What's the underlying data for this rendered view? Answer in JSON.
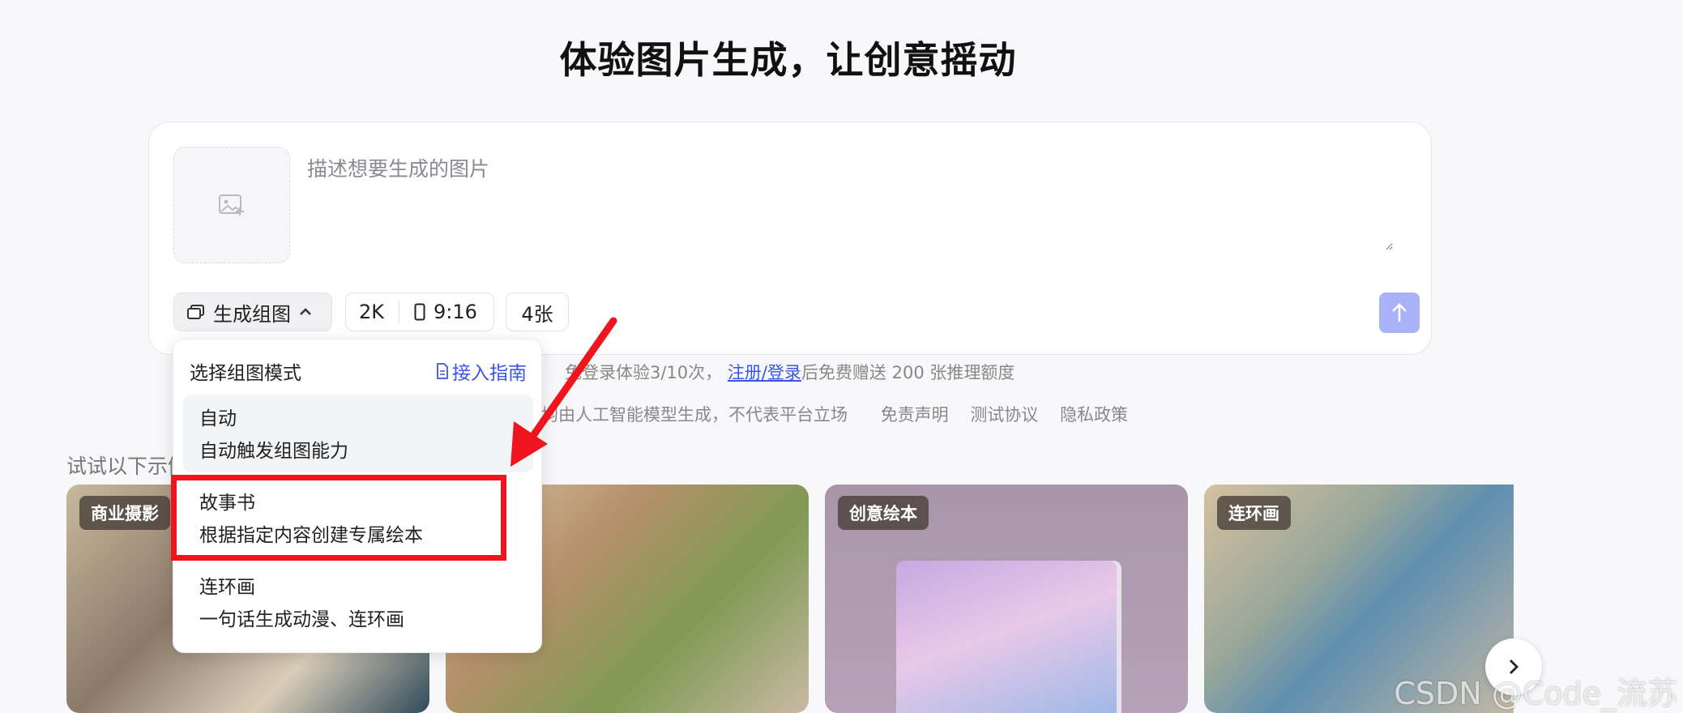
{
  "title": "体验图片生成，让创意摇动",
  "prompt": {
    "placeholder": "描述想要生成的图片"
  },
  "options": {
    "mode_label": "生成组图",
    "resolution": "2K",
    "ratio": "9:16",
    "count": "4张"
  },
  "notes": {
    "quota_text": "免登录体验3/10次，",
    "register_link": "注册/登录",
    "gift_text": "后免费赠送 200 张推理额度",
    "disclaimer": "均由人工智能模型生成，不代表平台立场",
    "links": [
      "免责声明",
      "测试协议",
      "隐私政策"
    ]
  },
  "try_label": "试试以下示例",
  "dropdown": {
    "title": "选择组图模式",
    "guide": "接入指南",
    "items": [
      {
        "title": "自动",
        "desc": "自动触发组图能力"
      },
      {
        "title": "故事书",
        "desc": "根据指定内容创建专属绘本"
      },
      {
        "title": "连环画",
        "desc": "一句话生成动漫、连环画"
      }
    ]
  },
  "examples": [
    {
      "badge": "商业摄影"
    },
    {
      "badge": ""
    },
    {
      "badge": "创意绘本"
    },
    {
      "badge": "连环画"
    }
  ],
  "watermark": "CSDN @Code_流苏",
  "colors": {
    "accent": "#3a55e6",
    "send": "#a9b2f6",
    "highlight": "#f0141e"
  }
}
